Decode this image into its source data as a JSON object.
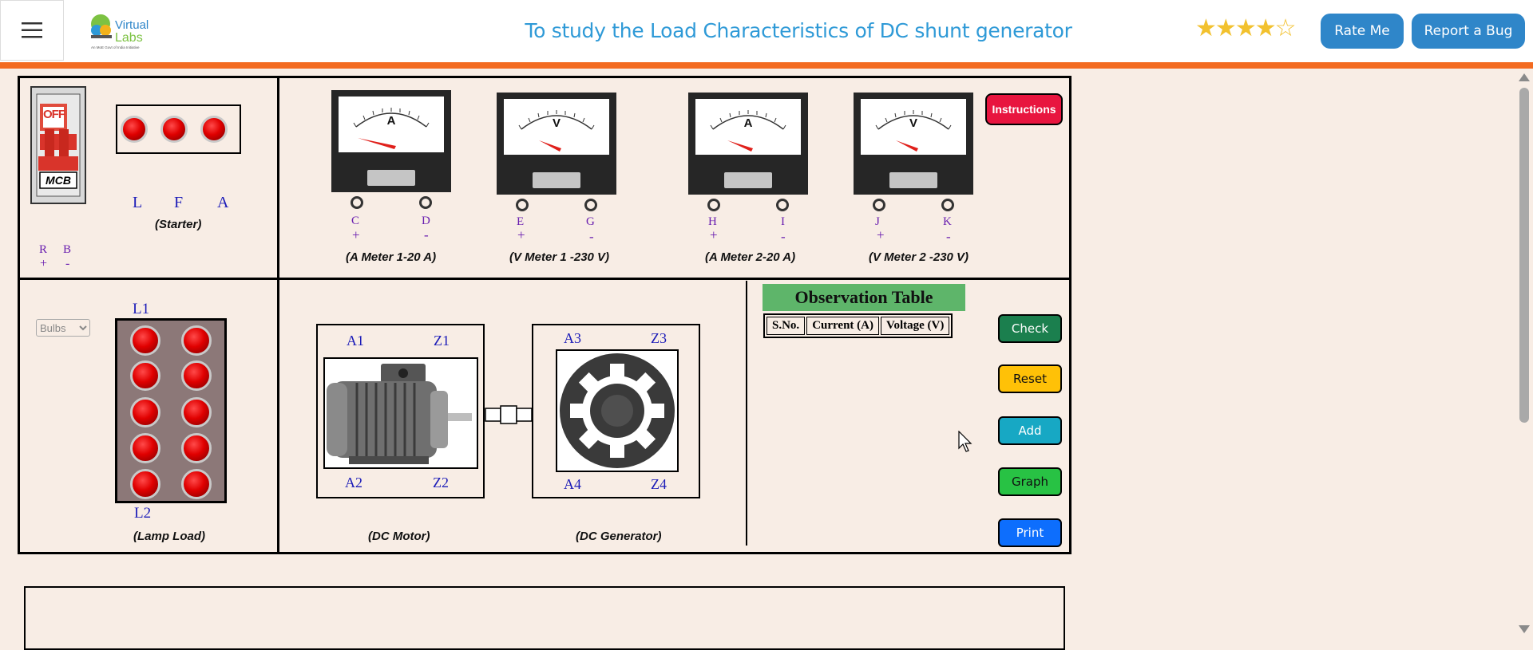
{
  "header": {
    "logo_text": "Virtual Labs",
    "logo_tagline": "An MoE Govt of India Initiative",
    "title": "To study the Load Characteristics of DC shunt generator",
    "rating_stars": 4,
    "rating_max": 5,
    "rate_button": "Rate Me",
    "bug_button": "Report a Bug"
  },
  "colors": {
    "accent_orange": "#f36b21",
    "title_blue": "#2f9ad7",
    "header_button": "#2f86c9",
    "instructions": "#e8153f",
    "check": "#1b7f4e",
    "reset": "#ffc107",
    "add": "#17a8c4",
    "graph": "#28c244",
    "print": "#0d6efd"
  },
  "mcb": {
    "state_label": "OFF",
    "label": "MCB"
  },
  "starter": {
    "terminals": [
      "L",
      "F",
      "A"
    ],
    "caption": "(Starter)"
  },
  "supply": {
    "labels": [
      "R",
      "B"
    ],
    "signs": [
      "+",
      "-"
    ]
  },
  "meters": [
    {
      "symbol": "A",
      "terminals": [
        "C",
        "D"
      ],
      "signs": [
        "+",
        "-"
      ],
      "caption": "(A Meter 1-20 A)"
    },
    {
      "symbol": "V",
      "terminals": [
        "E",
        "G"
      ],
      "signs": [
        "+",
        "-"
      ],
      "caption": "(V Meter 1 -230 V)"
    },
    {
      "symbol": "A",
      "terminals": [
        "H",
        "I"
      ],
      "signs": [
        "+",
        "-"
      ],
      "caption": "(A Meter 2-20 A)"
    },
    {
      "symbol": "V",
      "terminals": [
        "J",
        "K"
      ],
      "signs": [
        "+",
        "-"
      ],
      "caption": "(V Meter 2 -230 V)"
    }
  ],
  "instructions_button": "Instructions",
  "lamp_load": {
    "select_value": "Bulbs",
    "top_label": "L1",
    "bottom_label": "L2",
    "caption": "(Lamp Load)"
  },
  "motor": {
    "terminals": [
      "A1",
      "Z1",
      "A2",
      "Z2"
    ],
    "caption": "(DC Motor)"
  },
  "generator": {
    "terminals": [
      "A3",
      "Z3",
      "A4",
      "Z4"
    ],
    "caption": "(DC Generator)"
  },
  "observation": {
    "title": "Observation Table",
    "columns": [
      "S.No.",
      "Current (A)",
      "Voltage (V)"
    ]
  },
  "actions": {
    "check": "Check",
    "reset": "Reset",
    "add": "Add",
    "graph": "Graph",
    "print": "Print"
  }
}
